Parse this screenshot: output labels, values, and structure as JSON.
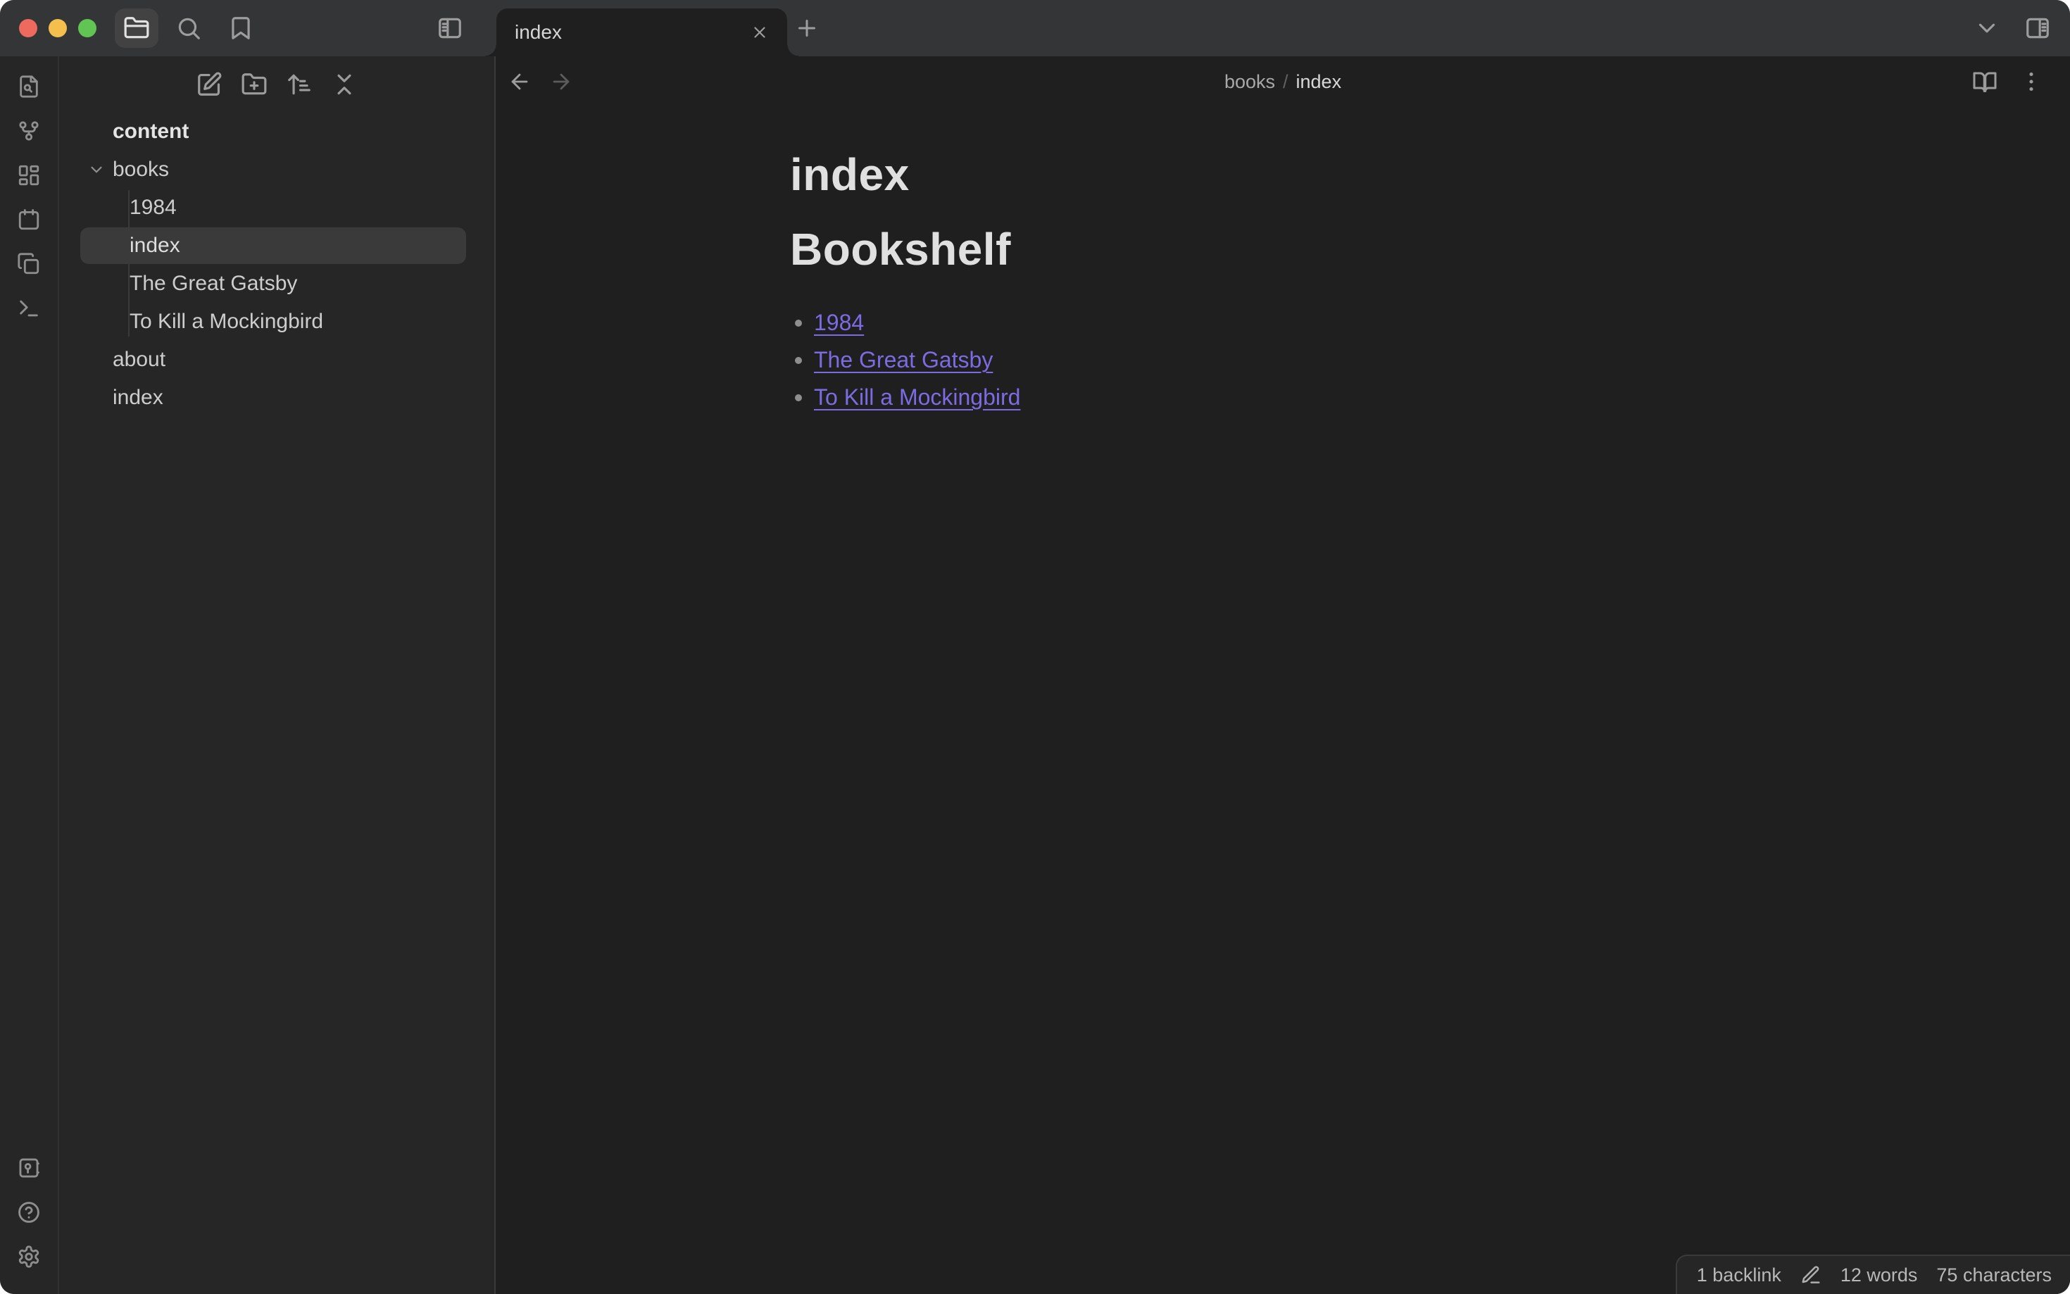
{
  "titlebar": {
    "tab_title": "index",
    "icons": [
      "folder-icon",
      "search-icon",
      "bookmark-icon",
      "panel-left-icon",
      "close-icon",
      "plus-icon",
      "chevron-down-icon",
      "panel-right-icon"
    ]
  },
  "ribbon": {
    "top_icons": [
      "file-search-icon",
      "graph-icon",
      "canvas-icon",
      "calendar-icon",
      "copy-icon",
      "terminal-icon"
    ],
    "bottom_icons": [
      "vault-icon",
      "help-icon",
      "settings-icon"
    ]
  },
  "explorer": {
    "toolbar_icons": [
      "new-note-icon",
      "new-folder-icon",
      "sort-icon",
      "collapse-all-icon"
    ],
    "vault_name": "content",
    "tree": {
      "folder_label": "books",
      "folder_expanded": true,
      "children": [
        "1984",
        "index",
        "The Great Gatsby",
        "To Kill a Mockingbird"
      ],
      "selected_item": "index",
      "root_items": [
        "about",
        "index"
      ]
    }
  },
  "editor": {
    "breadcrumb": {
      "parent": "books",
      "separator": "/",
      "current": "index"
    },
    "header_icons": [
      "back-icon",
      "forward-icon",
      "reading-mode-icon",
      "more-options-icon"
    ],
    "note_title": "index",
    "heading": "Bookshelf",
    "links": [
      "1984",
      "The Great Gatsby",
      "To Kill a Mockingbird"
    ]
  },
  "status_bar": {
    "backlinks": "1 backlink",
    "edit_icon": "edit-icon",
    "words": "12 words",
    "characters": "75 characters"
  },
  "colors": {
    "accent_link": "#7b6ce2",
    "titlebar_bg": "#343536",
    "sidebar_bg": "#262626",
    "editor_bg": "#1f1f1f",
    "selected_row_bg": "#3a3a3a",
    "traffic_red": "#ee6a5f",
    "traffic_yellow": "#f5bf4e",
    "traffic_green": "#61c554"
  }
}
